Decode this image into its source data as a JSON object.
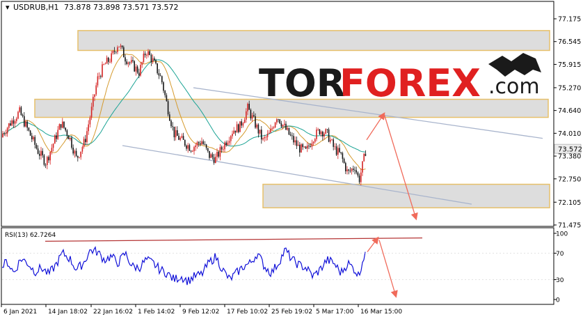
{
  "header": {
    "symbol": "USDRUB,H1",
    "ohlc": "73.878 73.898 73.571 73.572"
  },
  "watermark": {
    "brand_dark": "TOR",
    "brand_red": "FOREX",
    "brand_tld": ".com"
  },
  "colors": {
    "candle_up": "#d42222",
    "candle_down": "#151515",
    "ma_fast": "#d59a2e",
    "ma_slow": "#1aa394",
    "zone_fill": "#d9d9d9",
    "zone_border": "#e7c06a",
    "channel": "#a8b4cc",
    "arrow": "#f06a5a",
    "rsi_line": "#1010d8",
    "rsi_trend": "#b53535",
    "price_box": "#ececec"
  },
  "chart_data": [
    {
      "type": "candlestick",
      "name": "USDRUB,H1",
      "y_axis_ticks": [
        "77.175",
        "76.545",
        "75.915",
        "75.270",
        "74.640",
        "74.010",
        "73.380",
        "72.750",
        "72.105",
        "71.475"
      ],
      "ylim": [
        71.475,
        77.175
      ],
      "current_price": "73.572",
      "x_labels": [
        "6 Jan 2021",
        "14 Jan 18:02",
        "22 Jan 16:02",
        "1 Feb 14:02",
        "9 Feb 12:02",
        "17 Feb 10:02",
        "25 Feb 19:02",
        "5 Mar 17:00",
        "16 Mar 15:00"
      ],
      "price_path": [
        [
          0,
          73.9
        ],
        [
          15,
          74.3
        ],
        [
          28,
          74.6
        ],
        [
          40,
          74.1
        ],
        [
          55,
          73.5
        ],
        [
          66,
          73.2
        ],
        [
          78,
          73.8
        ],
        [
          88,
          74.3
        ],
        [
          100,
          73.9
        ],
        [
          110,
          73.3
        ],
        [
          122,
          73.8
        ],
        [
          132,
          74.7
        ],
        [
          140,
          75.5
        ],
        [
          150,
          75.9
        ],
        [
          160,
          76.1
        ],
        [
          170,
          76.5
        ],
        [
          180,
          76.1
        ],
        [
          190,
          75.9
        ],
        [
          200,
          75.7
        ],
        [
          210,
          76.3
        ],
        [
          220,
          76.0
        ],
        [
          232,
          75.5
        ],
        [
          240,
          74.8
        ],
        [
          250,
          74.0
        ],
        [
          262,
          73.8
        ],
        [
          275,
          73.6
        ],
        [
          290,
          73.8
        ],
        [
          300,
          73.4
        ],
        [
          310,
          73.3
        ],
        [
          322,
          73.7
        ],
        [
          335,
          74.1
        ],
        [
          345,
          74.2
        ],
        [
          356,
          74.7
        ],
        [
          366,
          74.3
        ],
        [
          378,
          73.8
        ],
        [
          388,
          74.0
        ],
        [
          398,
          74.5
        ],
        [
          408,
          74.2
        ],
        [
          418,
          73.9
        ],
        [
          430,
          73.6
        ],
        [
          440,
          73.5
        ],
        [
          450,
          73.9
        ],
        [
          460,
          74.1
        ],
        [
          470,
          74.0
        ],
        [
          480,
          73.6
        ],
        [
          490,
          73.4
        ],
        [
          500,
          72.9
        ],
        [
          510,
          73.1
        ],
        [
          516,
          72.7
        ],
        [
          522,
          73.2
        ],
        [
          526,
          73.572
        ]
      ],
      "zones": [
        {
          "from": 76.3,
          "to": 76.85
        },
        {
          "from": 74.45,
          "to": 74.95
        },
        {
          "from": 71.95,
          "to": 72.6
        }
      ],
      "channel_lines": [
        {
          "start": [
            278,
            75.27
          ],
          "end": [
            780,
            73.87
          ]
        },
        {
          "start": [
            176,
            73.67
          ],
          "end": [
            678,
            72.05
          ]
        }
      ],
      "forecast_arrows": [
        {
          "start": [
            527,
            73.83
          ],
          "end": [
            552,
            74.55
          ]
        },
        {
          "start": [
            552,
            74.55
          ],
          "end": [
            598,
            71.65
          ]
        }
      ]
    },
    {
      "type": "line",
      "name": "RSI(13)",
      "label": "RSI(13) 62.7264",
      "y_axis_ticks": [
        "100",
        "70",
        "30",
        "0"
      ],
      "ylim": [
        0,
        100
      ],
      "x": [
        0,
        10,
        20,
        30,
        40,
        50,
        60,
        70,
        80,
        90,
        100,
        110,
        120,
        130,
        140,
        150,
        160,
        170,
        180,
        190,
        200,
        210,
        220,
        230,
        240,
        250,
        260,
        270,
        280,
        290,
        300,
        310,
        320,
        330,
        340,
        350,
        360,
        370,
        380,
        390,
        400,
        410,
        420,
        430,
        440,
        450,
        460,
        470,
        480,
        490,
        500,
        510,
        516,
        520,
        526
      ],
      "values": [
        45,
        58,
        40,
        62,
        55,
        42,
        48,
        38,
        52,
        70,
        62,
        45,
        55,
        75,
        72,
        60,
        65,
        55,
        70,
        50,
        48,
        60,
        55,
        45,
        40,
        30,
        35,
        28,
        35,
        38,
        55,
        65,
        45,
        30,
        40,
        50,
        55,
        70,
        50,
        40,
        55,
        75,
        60,
        52,
        48,
        35,
        45,
        60,
        55,
        40,
        55,
        45,
        35,
        55,
        75
      ],
      "trend_line": {
        "start": [
          65,
          88
        ],
        "end": [
          607,
          93
        ]
      },
      "forecast_arrows": [
        {
          "start": [
            528,
            72
          ],
          "end": [
            543,
            93
          ]
        },
        {
          "start": [
            545,
            90
          ],
          "end": [
            569,
            5
          ]
        }
      ]
    }
  ]
}
